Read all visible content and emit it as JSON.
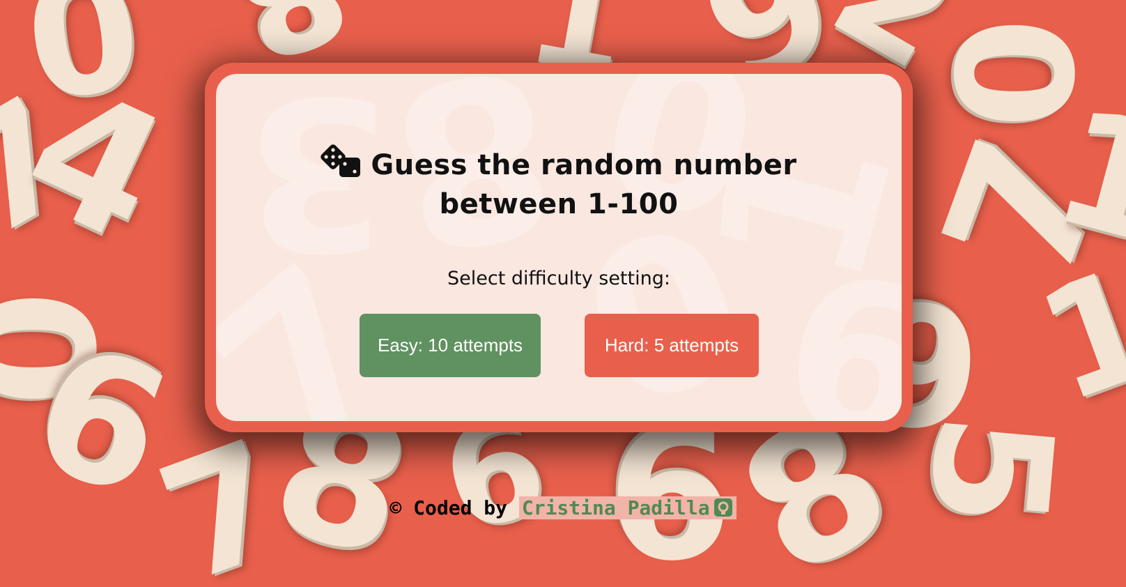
{
  "page": {
    "title_line1": "Guess the random number",
    "title_line2": "between 1-100",
    "title_icon": "dice-icon"
  },
  "difficulty": {
    "prompt": "Select difficulty setting:",
    "easy_label": "Easy: 10 attempts",
    "hard_label": "Hard: 5 attempts"
  },
  "footer": {
    "prefix": "© Coded by",
    "author": "Cristina Padilla",
    "author_icon": "github-icon"
  },
  "colors": {
    "background": "#e8604c",
    "card_fill": "#f9e7e0",
    "easy_button": "#609160",
    "hard_button": "#e8604c",
    "link_text": "#4f8a54"
  }
}
